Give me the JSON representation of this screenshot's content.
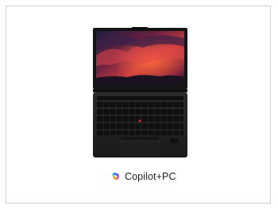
{
  "product": {
    "brand_label": "Copilot+PC",
    "icons": {
      "laptop": "laptop-image",
      "logo": "copilot-logo-icon"
    }
  }
}
